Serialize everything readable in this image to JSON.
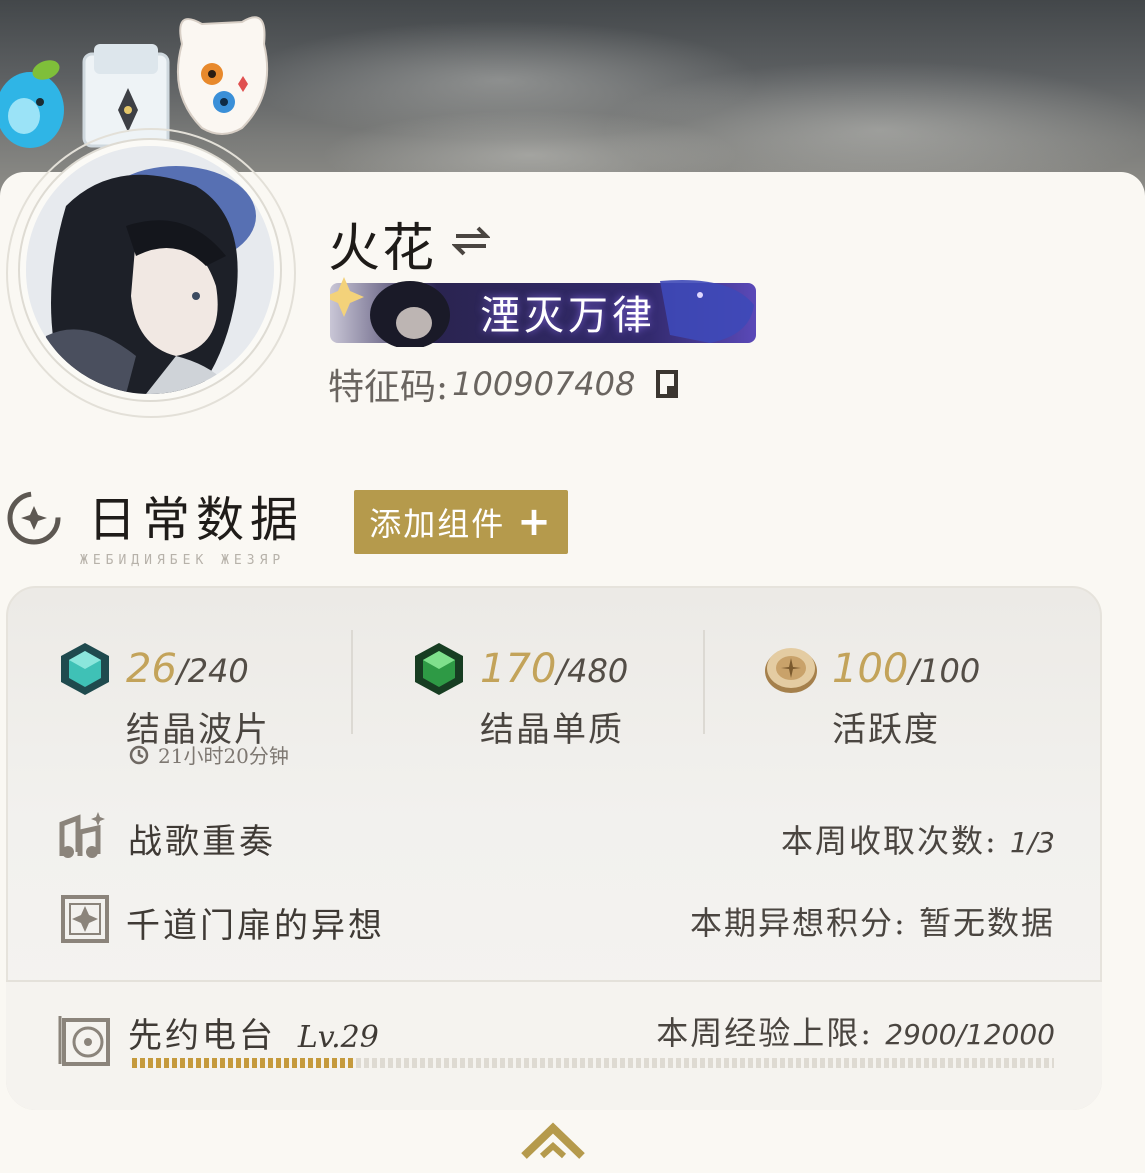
{
  "profile": {
    "name": "火花",
    "title_badge": "湮灭万律",
    "uid_label": "特征码:",
    "uid_value": "100907408"
  },
  "daily": {
    "section_title": "日常数据",
    "section_subtitle": "ЖЕБИДИЯБЕК ЖЕЗЯР",
    "add_widget_label": "添加组件",
    "stats": [
      {
        "current": "26",
        "max": "/240",
        "label": "结晶波片",
        "icon": "crystal-waveplate-icon",
        "color": "#2fa8a0"
      },
      {
        "current": "170",
        "max": "/480",
        "label": "结晶单质",
        "icon": "crystal-solvent-icon",
        "color": "#2e8f3e"
      },
      {
        "current": "100",
        "max": "/100",
        "label": "活跃度",
        "icon": "activity-coin-icon",
        "color": "#c9a26a"
      }
    ],
    "waveplate_timer": "21小时20分钟",
    "rows": [
      {
        "label": "战歌重奏",
        "value_prefix": "本周收取次数:",
        "value": "1/3",
        "icon": "battle-song-icon"
      },
      {
        "label": "千道门扉的异想",
        "value_prefix": "本期异想积分:",
        "value": "暂无数据",
        "icon": "doors-fantasy-icon"
      }
    ],
    "radio": {
      "label": "先约电台",
      "level": "Lv.29",
      "exp_prefix": "本周经验上限:",
      "exp_value": "2900/12000",
      "progress": 0.2417,
      "icon": "pioneer-radio-icon"
    }
  },
  "colors": {
    "accent_gold": "#b59a4c",
    "value_gold": "#c3a35a",
    "progress_fill": "#c59a3d"
  }
}
